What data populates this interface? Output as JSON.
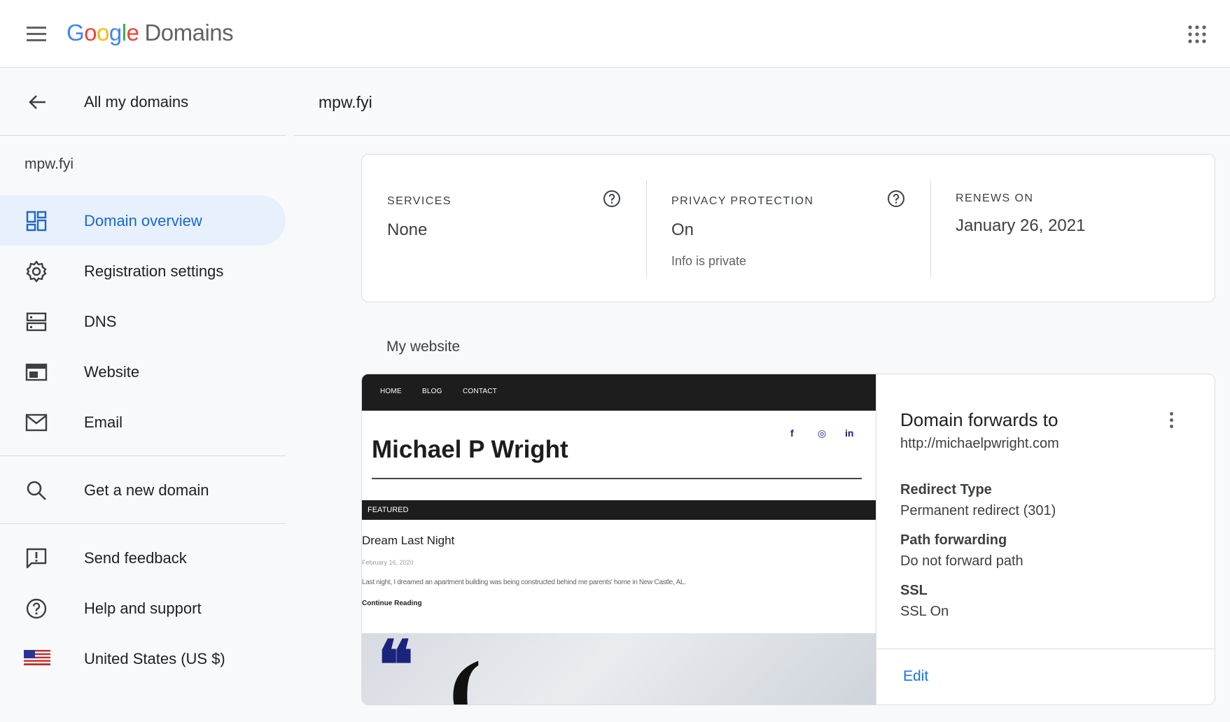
{
  "header": {
    "logo_letters": [
      "G",
      "o",
      "o",
      "g",
      "l",
      "e"
    ],
    "logo_product": "Domains",
    "brand_colors": {
      "blue": "#4285f4",
      "red": "#ea4335",
      "yellow": "#fbbc05",
      "green": "#34a853"
    },
    "menu_icon": "hamburger-menu-icon",
    "apps_icon": "apps-grid-icon"
  },
  "sidebar": {
    "back_label": "All my domains",
    "domain": "mpw.fyi",
    "items": [
      {
        "label": "Domain overview",
        "icon": "dashboard-icon",
        "active": true
      },
      {
        "label": "Registration settings",
        "icon": "gear-icon",
        "active": false
      },
      {
        "label": "DNS",
        "icon": "dns-icon",
        "active": false
      },
      {
        "label": "Website",
        "icon": "website-icon",
        "active": false
      },
      {
        "label": "Email",
        "icon": "mail-icon",
        "active": false
      }
    ],
    "secondary": [
      {
        "label": "Get a new domain",
        "icon": "search-icon"
      }
    ],
    "footer": [
      {
        "label": "Send feedback",
        "icon": "feedback-icon"
      },
      {
        "label": "Help and support",
        "icon": "help-icon"
      },
      {
        "label": "United States (US $)",
        "icon": "us-flag-icon"
      }
    ],
    "active_color": "#1967d2",
    "active_bg": "#e8f0fe"
  },
  "main": {
    "title": "mpw.fyi",
    "summary": {
      "services": {
        "caption": "SERVICES",
        "value": "None"
      },
      "privacy": {
        "caption": "PRIVACY PROTECTION",
        "value": "On",
        "sub": "Info is private"
      },
      "renews": {
        "caption": "RENEWS ON",
        "value": "January 26, 2021"
      }
    },
    "section_label": "My website",
    "preview": {
      "nav": [
        "HOME",
        "BLOG",
        "CONTACT"
      ],
      "site_title": "Michael P Wright",
      "social": [
        "f",
        "◎",
        "in"
      ],
      "featured_label": "FEATURED",
      "post_title": "Dream Last Night",
      "post_date": "February 16, 2020",
      "post_excerpt": "Last night, I dreamed an apartment building was being constructed behind me parents' home in New Castle, AL.",
      "read_more": "Continue Reading",
      "quote_glyph": "❝",
      "quote_glyph2": "("
    },
    "forwarding": {
      "title": "Domain forwards to",
      "url": "http://michaelpwright.com",
      "fields": [
        {
          "label": "Redirect Type",
          "value": "Permanent redirect (301)"
        },
        {
          "label": "Path forwarding",
          "value": "Do not forward path"
        },
        {
          "label": "SSL",
          "value": "SSL On"
        }
      ],
      "edit_label": "Edit",
      "link_color": "#1a73e8"
    }
  }
}
